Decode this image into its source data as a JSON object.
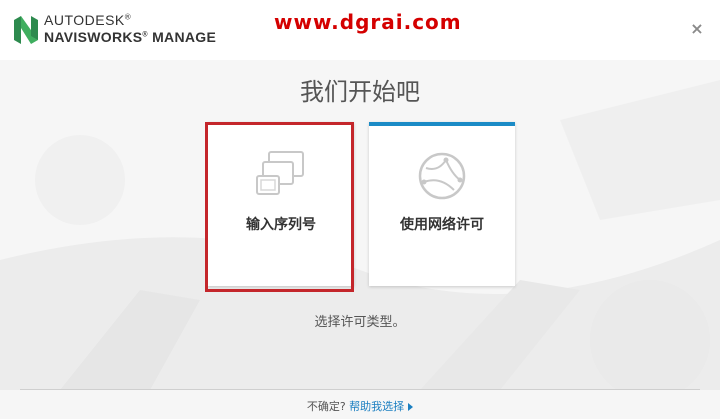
{
  "header": {
    "brand_line1": "AUTODESK",
    "registered_mark": "®",
    "brand_line2": "NAVISWORKS",
    "brand_line2_suffix": "MANAGE",
    "watermark": "www.dgrai.com",
    "close_label": "×"
  },
  "main": {
    "title": "我们开始吧",
    "cards": [
      {
        "label": "输入序列号",
        "icon": "devices-icon",
        "highlighted": true
      },
      {
        "label": "使用网络许可",
        "icon": "globe-network-icon",
        "accent": "#1b8bc6"
      }
    ],
    "instruction": "选择许可类型。"
  },
  "footer": {
    "question": "不确定?",
    "help_link": "帮助我选择"
  },
  "colors": {
    "highlight_border": "#c4262b",
    "accent_blue": "#1b8bc6",
    "watermark_red": "#d40000"
  }
}
